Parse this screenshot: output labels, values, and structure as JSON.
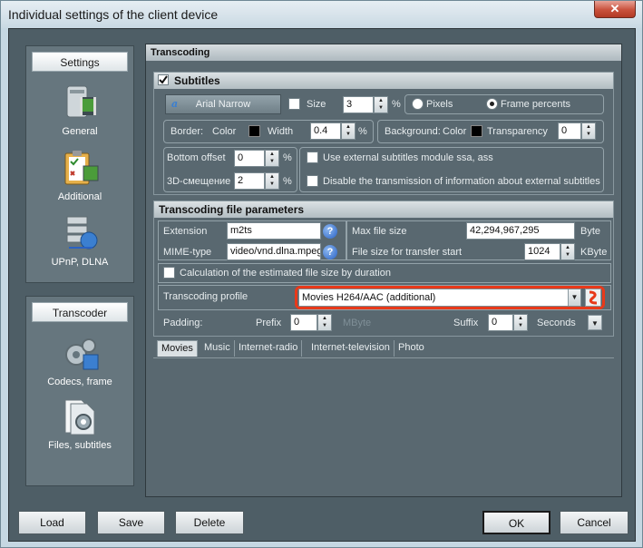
{
  "window": {
    "title": "Individual settings of the client device",
    "close": "✕"
  },
  "nav": {
    "settings_header": "Settings",
    "items": [
      {
        "label": "General"
      },
      {
        "label": "Additional"
      },
      {
        "label": "UPnP, DLNA"
      }
    ],
    "transcoder_header": "Transcoder",
    "transcoder_items": [
      {
        "label": "Codecs, frame"
      },
      {
        "label": "Files, subtitles"
      }
    ]
  },
  "panel": {
    "title": "Transcoding"
  },
  "subtitles": {
    "title": "Subtitles",
    "checked": true,
    "font_button": "Arial Narrow",
    "size_label": "Size",
    "size_value": "3",
    "size_unit": "%",
    "pixels_label": "Pixels",
    "frame_percents_label": "Frame percents",
    "border_label": "Border:",
    "color_label": "Color",
    "width_label": "Width",
    "width_value": "0.4",
    "width_unit": "%",
    "background_label": "Background:",
    "bg_color_label": "Color",
    "transparency_label": "Transparency",
    "transparency_value": "0",
    "bottom_offset_label": "Bottom offset",
    "bottom_offset_value": "0",
    "bottom_offset_unit": "%",
    "offset3d_label": "3D-смещение",
    "offset3d_value": "2",
    "offset3d_unit": "%",
    "ext_module_label": "Use external subtitles module ssa, ass",
    "disable_transmission_label": "Disable the transmission of information about external subtitles"
  },
  "file_params": {
    "title": "Transcoding file parameters",
    "extension_label": "Extension",
    "extension_value": "m2ts",
    "mime_label": "MIME-type",
    "mime_value": "video/vnd.dlna.mpeg",
    "max_size_label": "Max file size",
    "max_size_value": "42,294,967,295",
    "max_size_unit": "Byte",
    "transfer_start_label": "File size for transfer start",
    "transfer_start_value": "1024",
    "transfer_start_unit": "KByte",
    "calc_label": "Calculation of the estimated file size by duration",
    "profile_label": "Transcoding profile",
    "profile_value": "Movies H264/AAC (additional)",
    "padding_label": "Padding:",
    "prefix_label": "Prefix",
    "prefix_value": "0",
    "prefix_unit": "MByte",
    "suffix_label": "Suffix",
    "suffix_value": "0",
    "suffix_unit": "Seconds"
  },
  "tabs": [
    "Movies",
    "Music",
    "Internet-radio",
    "Internet-television",
    "Photo"
  ],
  "buttons": {
    "load": "Load",
    "save": "Save",
    "delete": "Delete",
    "ok": "OK",
    "cancel": "Cancel"
  },
  "colors": {
    "highlight": "#e8391a",
    "panel": "#596870"
  }
}
